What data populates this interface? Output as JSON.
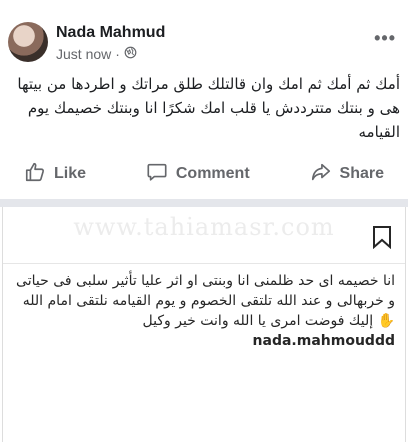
{
  "post": {
    "author": "Nada Mahmud",
    "timestamp": "Just now",
    "privacy_icon": "globe-icon",
    "more_icon": "more-options-icon",
    "text": "أمك ثم أمك ثم امك وان قالتلك طلق مراتك و اطردها من بيتها هى و بنتك متترددش يا قلب امك شكرًا انا وبنتك خصيمك يوم القيامه",
    "actions": {
      "like": "Like",
      "comment": "Comment",
      "share": "Share"
    }
  },
  "watermark": "www.tahiamasr.com",
  "instagram": {
    "bookmark_icon": "bookmark-icon",
    "username": "nada.mahmouddd",
    "caption": "انا خصيمه اى حد ظلمنى انا وبنتى او اثر عليا تأثير سلبى فى حياتى و خربهالى و عند الله تلتقى الخصوم و يوم القيامه نلتقى امام الله",
    "caption_end": "إليك فوضت امرى يا الله وانت خير وكيل",
    "hand_emoji": "✋"
  }
}
